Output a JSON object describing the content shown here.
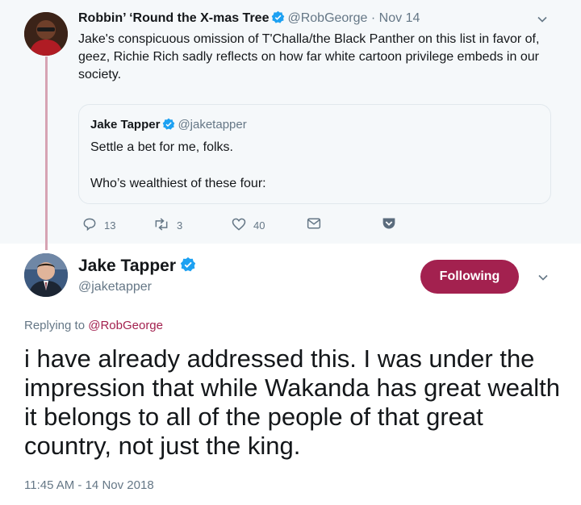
{
  "parent_tweet": {
    "author_name": "Robbin’ ‘Round the X-mas Tree",
    "handle": "@RobGeorge",
    "separator": "·",
    "date": "Nov 14",
    "text": "Jake's conspicuous omission of T'Challa/the Black Panther on this list in favor of, geez, Richie Rich sadly reflects on how far white cartoon privilege embeds in our society.",
    "quoted": {
      "author_name": "Jake Tapper",
      "handle": "@jaketapper",
      "line1": "Settle a bet for me, folks.",
      "line2": "Who’s wealthiest of these four:"
    },
    "actions": {
      "reply_count": "13",
      "retweet_count": "3",
      "like_count": "40"
    }
  },
  "main_tweet": {
    "author_name": "Jake Tapper",
    "handle": "@jaketapper",
    "follow_label": "Following",
    "replying_prefix": "Replying to",
    "replying_handle": "@RobGeorge",
    "text": "i have already addressed this. I was under the impression that while Wakanda has great wealth it belongs to all of the people of that great country, not just the king.",
    "timestamp": "11:45 AM - 14 Nov 2018"
  },
  "colors": {
    "accent": "#a3214f",
    "verified": "#1da1f2",
    "muted": "#657786",
    "parent_bg": "#f5f8fa"
  },
  "icons": [
    "reply-icon",
    "retweet-icon",
    "like-icon",
    "direct-message-icon",
    "pocket-icon",
    "chevron-down-icon",
    "verified-badge-icon"
  ]
}
